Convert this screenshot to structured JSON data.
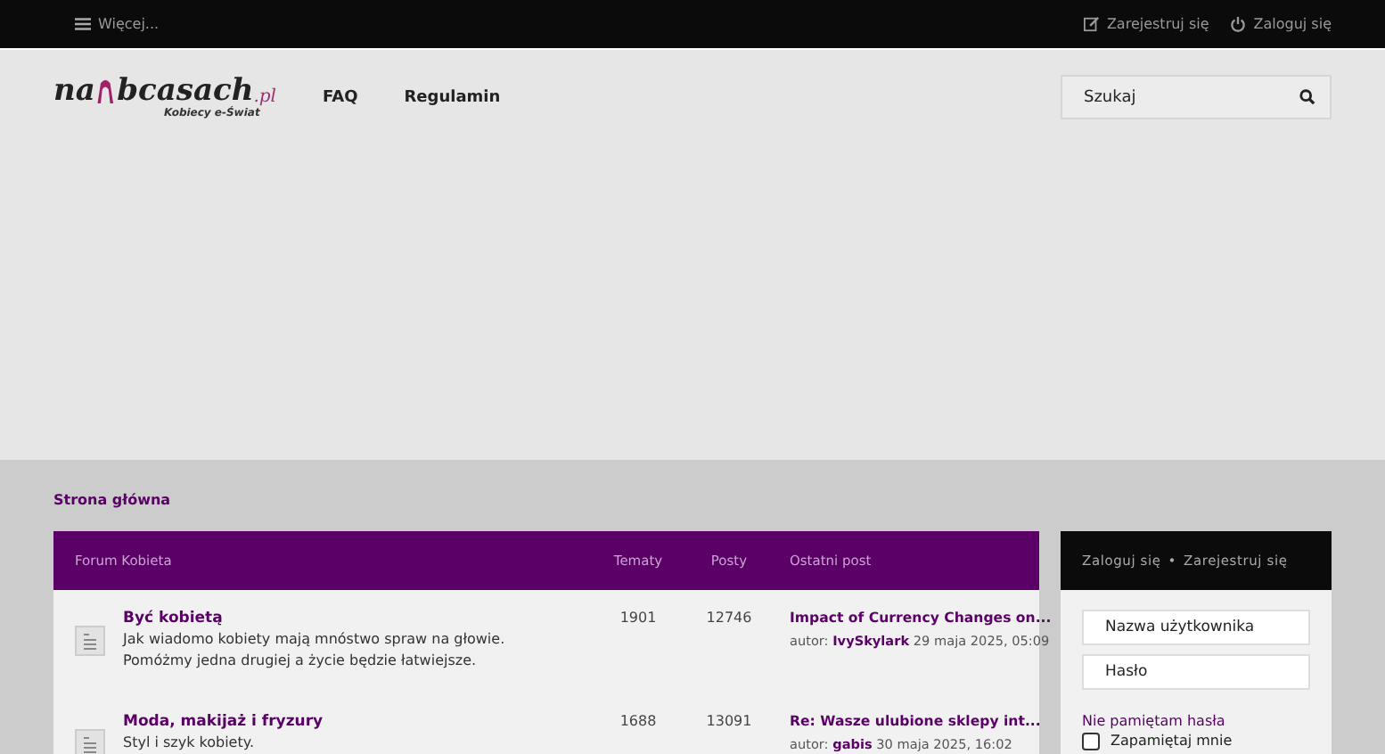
{
  "top_bar": {
    "menu": "Więcej...",
    "links": [
      {
        "kind": "register",
        "label": "Zarejestruj się"
      },
      {
        "kind": "login",
        "label": "Zaloguj się"
      }
    ]
  },
  "header": {
    "logo": {
      "name_start": "na",
      "name_end": "bcasach",
      "domain": ".pl",
      "tagline": "Kobiecy e-Świat"
    },
    "nav": [
      "FAQ",
      "Regulamin"
    ],
    "search": {
      "placeholder": "Szukaj"
    }
  },
  "breadcrumb": "Strona główna",
  "forum_table": {
    "columns": [
      "Forum Kobieta",
      "Tematy",
      "Posty",
      "Ostatni post"
    ],
    "rows": [
      {
        "title": "Być kobietą",
        "description": "Jak wiadomo kobiety mają mnóstwo spraw na głowie. Pomóżmy jedna drugiej a życie będzie łatwiejsze.",
        "topics": "1901",
        "posts": "12746",
        "last_post": {
          "title": "Impact of Currency Changes on...",
          "by": "autor:",
          "author": "IvySkylark",
          "date": "29 maja 2025, 05:09"
        }
      },
      {
        "title": "Moda, makijaż i fryzury",
        "description": "Styl i szyk kobiety.",
        "topics": "1688",
        "posts": "13091",
        "last_post": {
          "title": "Re: Wasze ulubione sklepy int...",
          "by": "autor:",
          "author": "gabis",
          "date": "30 maja 2025, 16:02"
        }
      }
    ]
  },
  "login_panel": {
    "links": [
      "Zaloguj się",
      "Zarejestruj się"
    ],
    "separator": "•",
    "username": {
      "placeholder": "Nazwa użytkownika"
    },
    "password": {
      "placeholder": "Hasło"
    },
    "forgot": "Nie pamiętam hasła",
    "remember": {
      "label": "Zapamiętaj mnie",
      "checked": false
    }
  }
}
